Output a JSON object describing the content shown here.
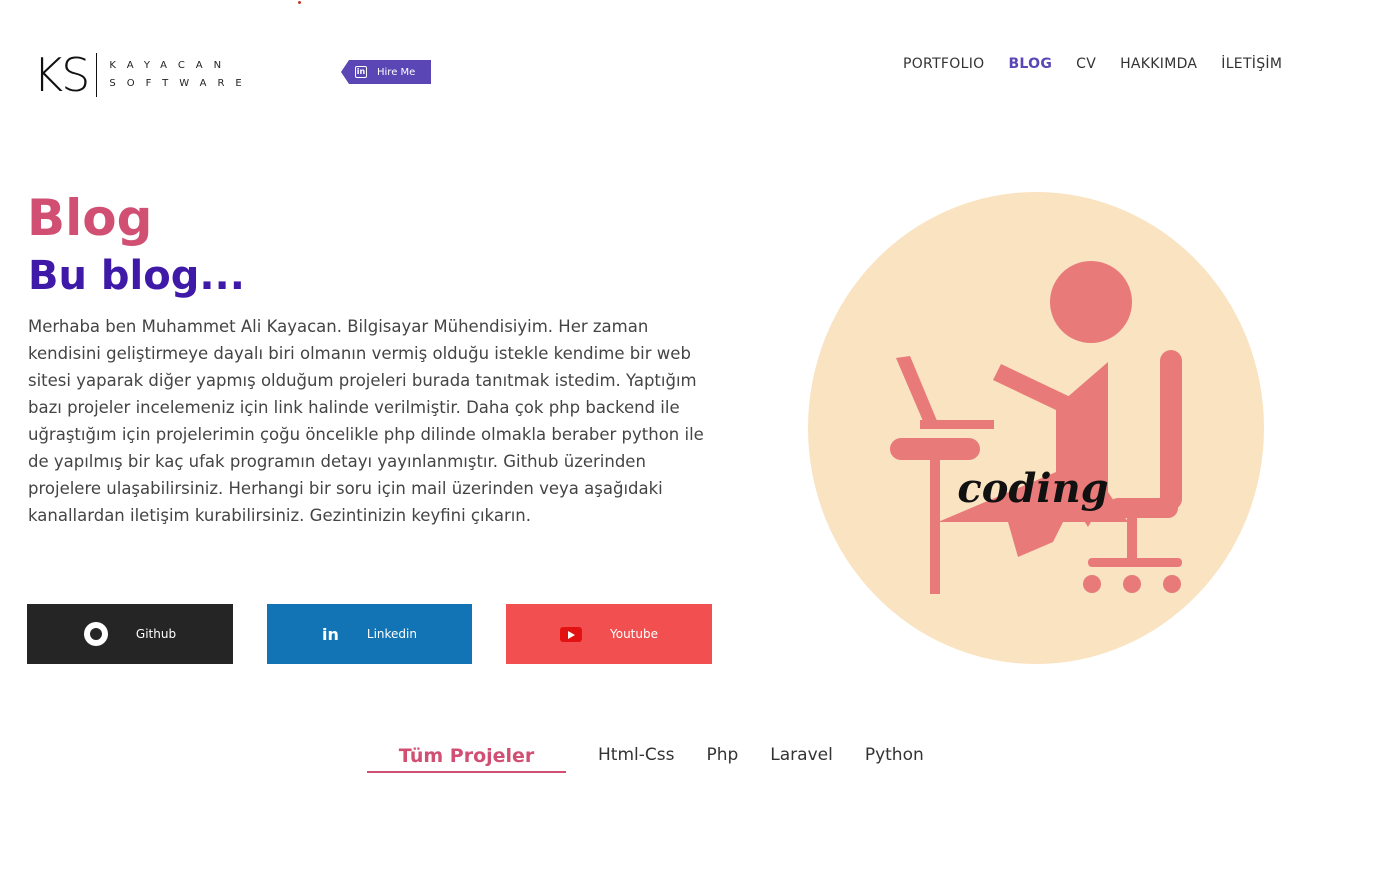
{
  "brand": {
    "initials": "KS",
    "line1": "KAYACAN",
    "line2": "SOFTWARE"
  },
  "hire_me": {
    "label": "Hire Me",
    "icon": "linkedin-icon"
  },
  "nav": {
    "items": [
      {
        "label": "PORTFOLIO",
        "active": false
      },
      {
        "label": "BLOG",
        "active": true
      },
      {
        "label": "CV",
        "active": false
      },
      {
        "label": "HAKKIMDA",
        "active": false
      },
      {
        "label": "İLETİŞİM",
        "active": false
      }
    ]
  },
  "hero": {
    "title": "Blog",
    "subtitle": "Bu blog...",
    "text": "Merhaba ben Muhammet Ali Kayacan. Bilgisayar Mühendisiyim. Her zaman kendisini geliştirmeye dayalı biri olmanın vermiş olduğu istekle kendime bir web sitesi yaparak diğer yapmış olduğum projeleri burada tanıtmak istedim. Yaptığım bazı projeler incelemeniz için link halinde verilmiştir. Daha çok php backend ile uğraştığım için projelerimin çoğu öncelikle php dilinde olmakla beraber python ile de yapılmış bir kaç ufak programın detayı yayınlanmıştır. Github üzerinden projelere ulaşabilirsiniz. Herhangi bir soru için mail üzerinden veya aşağıdaki kanallardan iletişim kurabilirsiniz. Gezintinizin keyfini çıkarın."
  },
  "social": {
    "github": {
      "label": "Github",
      "icon": "github-icon",
      "color": "#252525"
    },
    "linkedin": {
      "label": "Linkedin",
      "icon": "linkedin-icon",
      "color": "#1274b5"
    },
    "youtube": {
      "label": "Youtube",
      "icon": "youtube-icon",
      "color": "#f25050"
    }
  },
  "illustration": {
    "caption": "coding"
  },
  "tabs": [
    {
      "label": "Tüm Projeler",
      "active": true
    },
    {
      "label": "Html-Css",
      "active": false
    },
    {
      "label": "Php",
      "active": false
    },
    {
      "label": "Laravel",
      "active": false
    },
    {
      "label": "Python",
      "active": false
    }
  ],
  "colors": {
    "accent": "#d04f72",
    "primary": "#3f1aa8",
    "nav_active": "#5a46b5"
  }
}
